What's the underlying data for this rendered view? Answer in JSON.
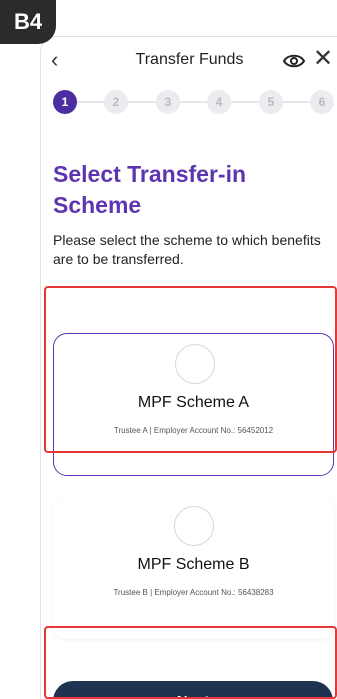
{
  "badge": "B4",
  "header": {
    "title": "Transfer Funds",
    "back_icon": "chevron-left-icon",
    "eye_icon": "eye-icon",
    "close_icon": "close-icon"
  },
  "stepper": {
    "steps": [
      "1",
      "2",
      "3",
      "4",
      "5",
      "6"
    ],
    "active_step": 1,
    "active_color": "#4b2fa0"
  },
  "main": {
    "heading": "Select Transfer-in Scheme",
    "description": "Please select the scheme to which benefits are to be transferred.",
    "schemes": [
      {
        "name": "MPF Scheme A",
        "trustee": "Trustee A",
        "account_label": "| Employer Account No.:",
        "account_no": "56452012",
        "selected": true
      },
      {
        "name": "MPF Scheme B",
        "trustee": "Trustee B",
        "account_label": "| Employer Account No.:",
        "account_no": "56438283",
        "selected": false
      }
    ]
  },
  "footer": {
    "next_label": "Next"
  },
  "colors": {
    "accent": "#5e35b1",
    "button": "#1e3352",
    "highlight": "#e53935"
  }
}
